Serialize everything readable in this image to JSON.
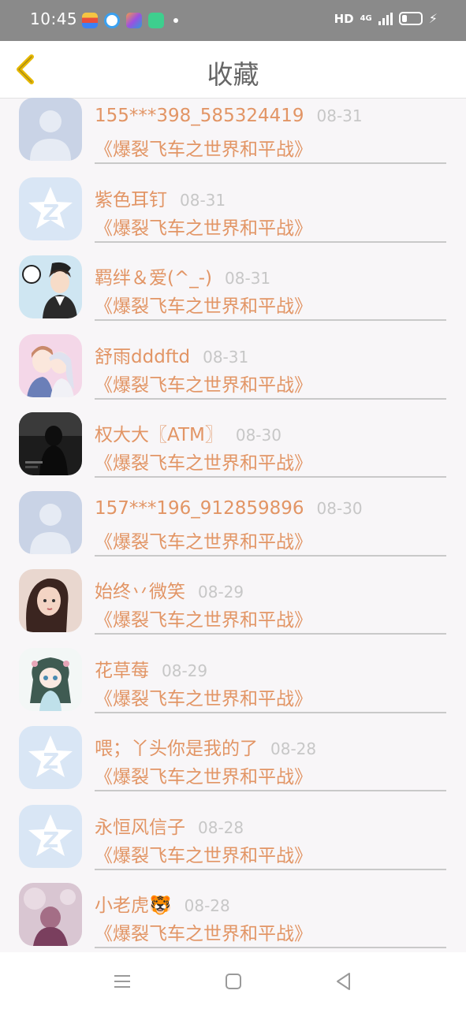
{
  "status_bar": {
    "time": "10:45",
    "network": "HD",
    "signal": "4G"
  },
  "header": {
    "title": "收藏",
    "back_icon": "chevron-left-icon",
    "back_color": "#e6b800"
  },
  "colors": {
    "name": "#e29565",
    "date": "#c7c7c7",
    "book": "#e29565",
    "background": "#f8f6f8"
  },
  "favorites": [
    {
      "name": "155***398_585324419",
      "date": "08-31",
      "book": "《爆裂飞车之世界和平战》",
      "avatar": "default-person"
    },
    {
      "name": "紫色耳钉",
      "date": "08-31",
      "book": "《爆裂飞车之世界和平战》",
      "avatar": "qzone-star"
    },
    {
      "name": "羁绊＆爱(^_-)",
      "date": "08-31",
      "book": "《爆裂飞车之世界和平战》",
      "avatar": "anime-boy-soccer"
    },
    {
      "name": "舒雨dddftd",
      "date": "08-31",
      "book": "《爆裂飞车之世界和平战》",
      "avatar": "anime-couple"
    },
    {
      "name": "权大大〖ATM〗",
      "date": "08-30",
      "book": "《爆裂飞车之世界和平战》",
      "avatar": "dark-girl-photo"
    },
    {
      "name": "157***196_912859896",
      "date": "08-30",
      "book": "《爆裂飞车之世界和平战》",
      "avatar": "default-person"
    },
    {
      "name": "始终丷微笑",
      "date": "08-29",
      "book": "《爆裂飞车之世界和平战》",
      "avatar": "girl-portrait"
    },
    {
      "name": "花草莓",
      "date": "08-29",
      "book": "《爆裂飞车之世界和平战》",
      "avatar": "anime-chibi-girl"
    },
    {
      "name": "喂；丫头你是我的了",
      "date": "08-28",
      "book": "《爆裂飞车之世界和平战》",
      "avatar": "qzone-star"
    },
    {
      "name": "永恒风信子",
      "date": "08-28",
      "book": "《爆裂飞车之世界和平战》",
      "avatar": "qzone-star"
    },
    {
      "name": "小老虎🐯",
      "date": "08-28",
      "book": "《爆裂飞车之世界和平战》",
      "avatar": "pink-blur-photo"
    }
  ],
  "nav_bar": {
    "menu_icon": "menu-icon",
    "home_icon": "home-square-icon",
    "back_icon": "back-triangle-icon"
  }
}
